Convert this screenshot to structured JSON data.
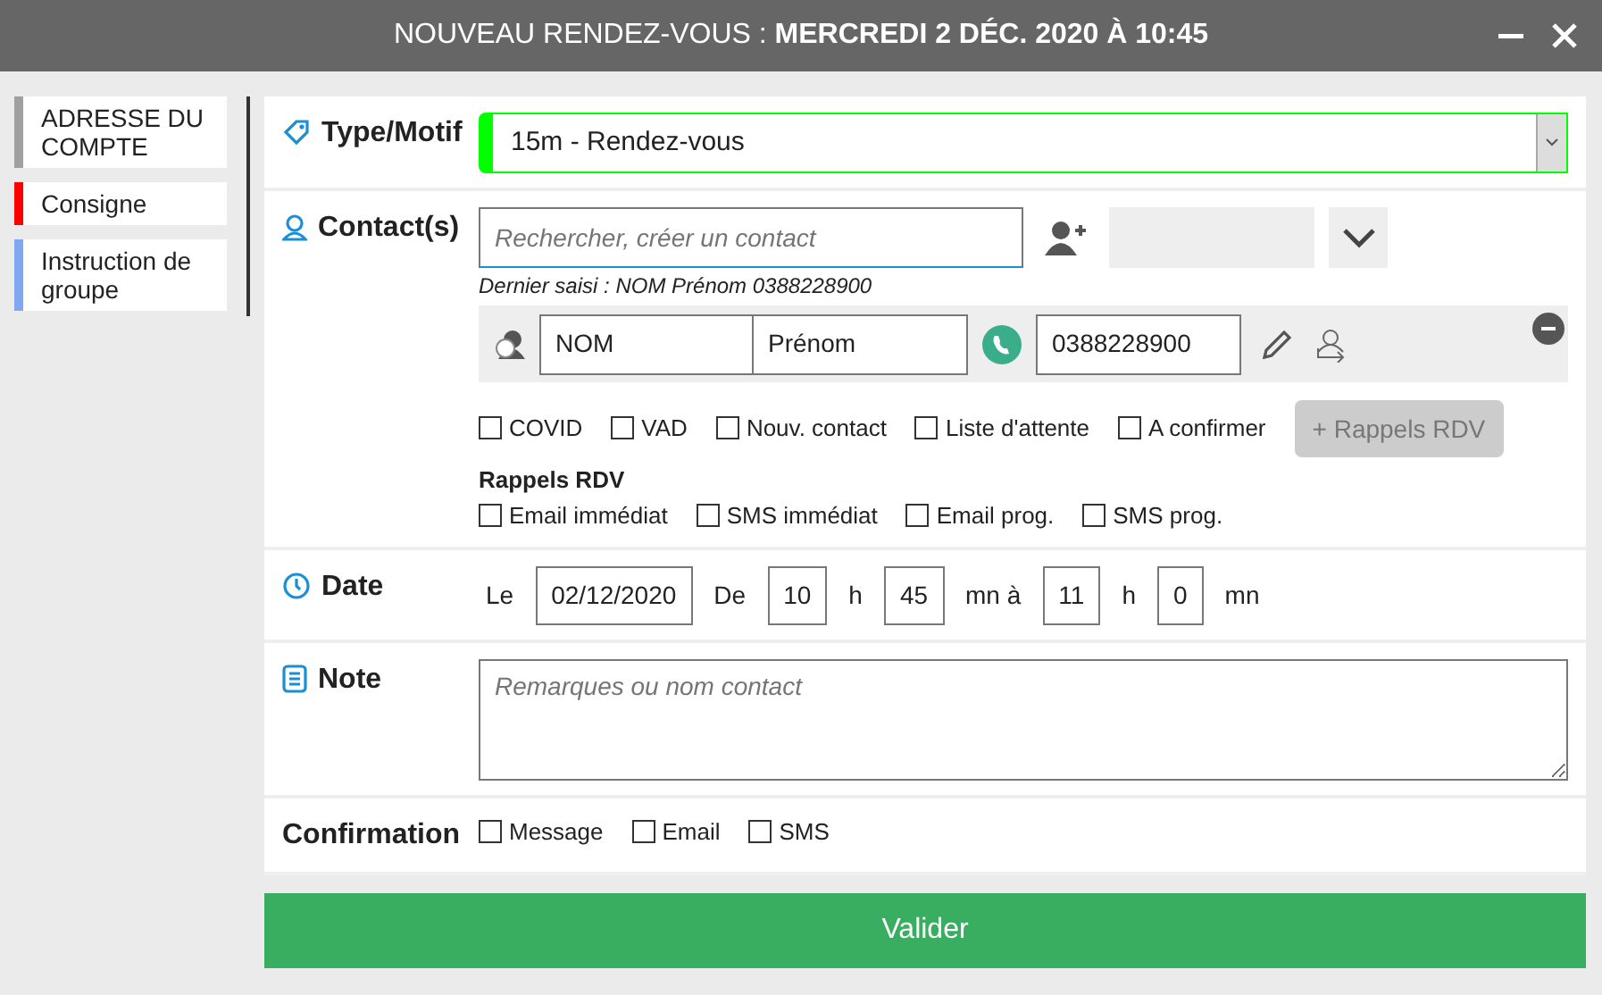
{
  "window": {
    "title": "NOUVEAU RENDEZ-VOUS : **MERCREDI 2 DÉC. 2020 À 10:45**"
  },
  "sidebar": {
    "items": [
      {
        "label": "ADRESSE DU COMPTE",
        "color": "#a0a0a0"
      },
      {
        "label": "Consigne",
        "color": "#ff0000"
      },
      {
        "label": "Instruction de groupe",
        "color": "#7fa8f0"
      }
    ]
  },
  "type_motif": {
    "label": "Type/Motif",
    "value": "15m - Rendez-vous"
  },
  "contacts": {
    "label": "Contact(s)",
    "search": {
      "placeholder": "Rechercher, créer un contact"
    },
    "last_entry": "Dernier saisi : NOM Prénom 0388228900",
    "contact": {
      "name": "NOM",
      "first_name": "Prénom",
      "phone": "0388228900"
    },
    "options": [
      {
        "label": "COVID",
        "checked": false
      },
      {
        "label": "VAD",
        "checked": false
      },
      {
        "label": "Nouv. contact",
        "checked": false
      },
      {
        "label": "Liste d'attente",
        "checked": false
      },
      {
        "label": "A confirmer",
        "checked": false
      }
    ],
    "reminders_button": {
      "label": "+ Rappels RDV",
      "disabled": true
    },
    "reminders": {
      "title": "Rappels RDV",
      "options": [
        {
          "label": "Email immédiat",
          "checked": false
        },
        {
          "label": "SMS immédiat",
          "checked": false
        },
        {
          "label": "Email prog.",
          "checked": false
        },
        {
          "label": "SMS prog.",
          "checked": false
        }
      ]
    }
  },
  "date": {
    "label": "Date",
    "items": [
      {
        "kind": "text",
        "text": "Le"
      },
      {
        "kind": "field",
        "value": "02/12/2020"
      },
      {
        "kind": "text",
        "text": "De"
      },
      {
        "kind": "field",
        "value": "10"
      },
      {
        "kind": "text",
        "text": "h"
      },
      {
        "kind": "field",
        "value": "45"
      },
      {
        "kind": "text",
        "text": "mn à"
      },
      {
        "kind": "field",
        "value": "11"
      },
      {
        "kind": "text",
        "text": "h"
      },
      {
        "kind": "field",
        "value": "0"
      },
      {
        "kind": "text",
        "text": "mn"
      }
    ]
  },
  "note": {
    "label": "Note",
    "placeholder": "Remarques ou nom contact"
  },
  "confirmation": {
    "label": "Confirmation",
    "options": [
      {
        "label": "Message",
        "checked": false
      },
      {
        "label": "Email",
        "checked": false
      },
      {
        "label": "SMS",
        "checked": false
      }
    ]
  },
  "submit": {
    "label": "Valider"
  }
}
